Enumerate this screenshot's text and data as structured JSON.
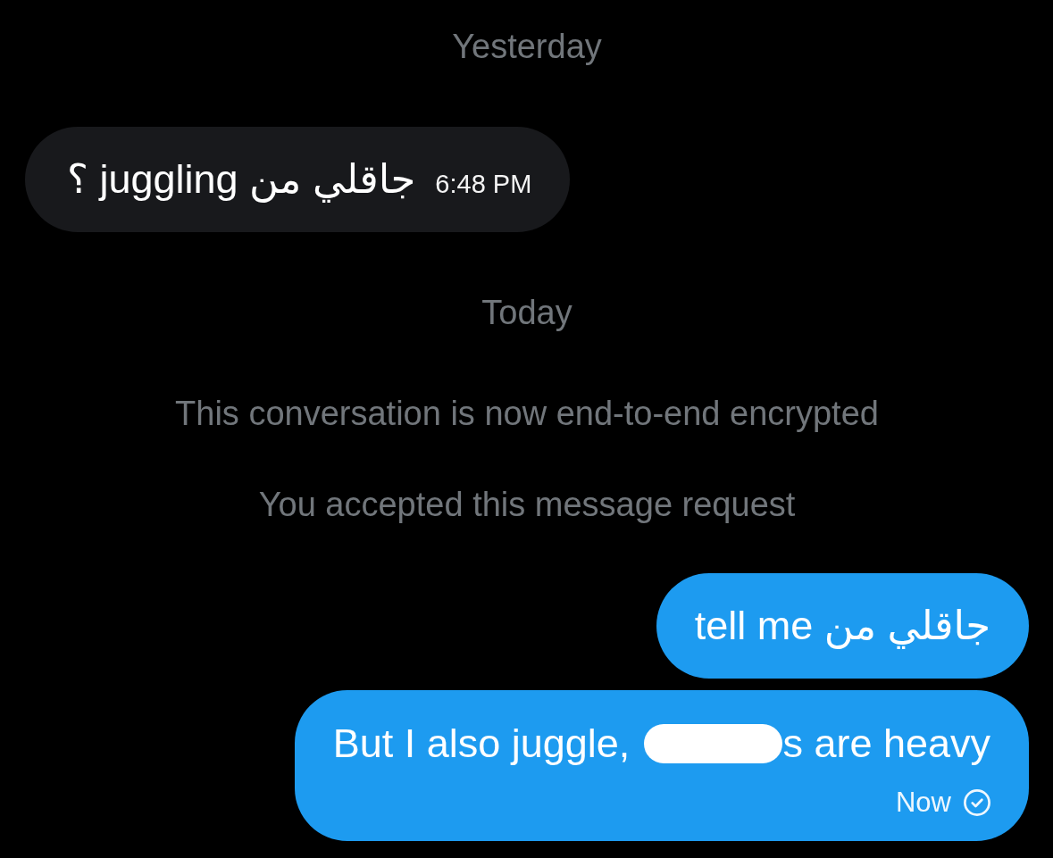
{
  "days": [
    {
      "label": "Yesterday",
      "items": [
        {
          "kind": "received",
          "parts": [
            {
              "kind": "text",
              "text": "جاقلي من juggling ؟"
            }
          ],
          "time": "6:48 PM"
        }
      ]
    },
    {
      "label": "Today",
      "items": [
        {
          "kind": "notice",
          "text": "This conversation is now end-to-end encrypted"
        },
        {
          "kind": "notice",
          "text": "You accepted this message request"
        },
        {
          "kind": "sent",
          "parts": [
            {
              "kind": "text",
              "text": "جاقلي من tell me"
            }
          ]
        },
        {
          "kind": "sent",
          "parts": [
            {
              "kind": "text",
              "text": "But I also juggle,"
            },
            {
              "kind": "redaction"
            },
            {
              "kind": "text",
              "text": "s are heavy"
            }
          ],
          "time": "Now"
        }
      ]
    }
  ]
}
